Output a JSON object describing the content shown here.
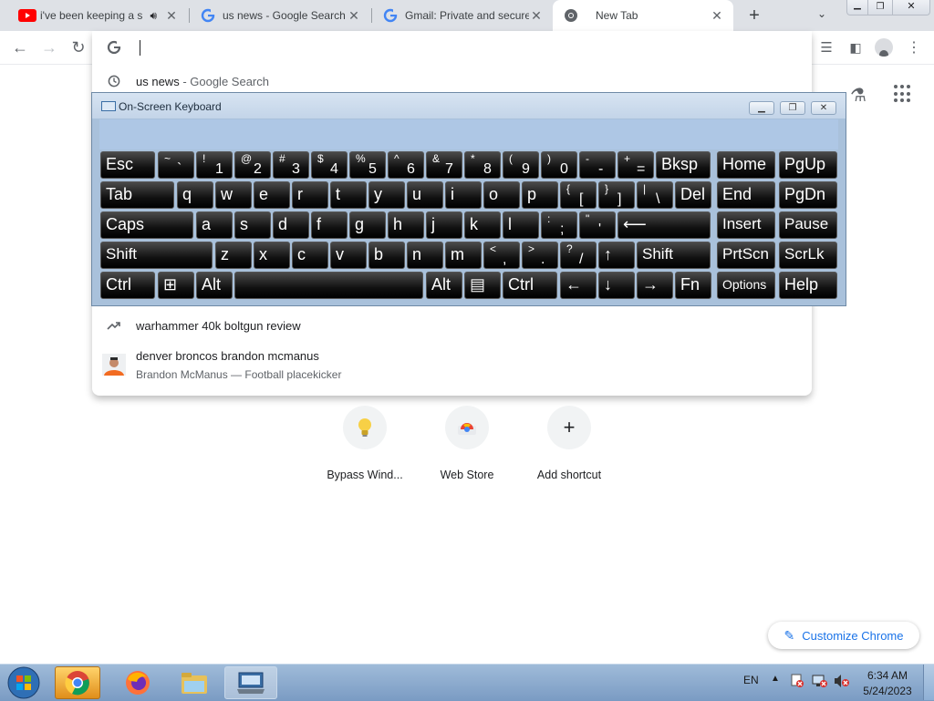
{
  "tabs": [
    {
      "title": "i've been keeping a s",
      "icon": "youtube-icon"
    },
    {
      "title": "us news - Google Search",
      "icon": "google-icon"
    },
    {
      "title": "Gmail: Private and secure",
      "icon": "google-icon"
    },
    {
      "title": "New Tab",
      "icon": "chrome-icon"
    }
  ],
  "new_tab_symbol": "+",
  "omnibox": {
    "value": ""
  },
  "suggestions": [
    {
      "text": "us news",
      "suffix": " - Google Search",
      "icon": "history-icon"
    },
    {
      "text": "warhammer 40k boltgun review",
      "icon": "trending-icon"
    },
    {
      "text": "denver broncos brandon mcmanus",
      "subtitle": "Brandon McManus — Football placekicker",
      "icon": "person-thumbnail"
    }
  ],
  "osk": {
    "title": "On-Screen Keyboard",
    "rows": [
      [
        {
          "m": "Esc"
        },
        {
          "s": "~",
          "b": "`"
        },
        {
          "s": "!",
          "b": "1"
        },
        {
          "s": "@",
          "b": "2"
        },
        {
          "s": "#",
          "b": "3"
        },
        {
          "s": "$",
          "b": "4"
        },
        {
          "s": "%",
          "b": "5"
        },
        {
          "s": "^",
          "b": "6"
        },
        {
          "s": "&",
          "b": "7"
        },
        {
          "s": "*",
          "b": "8"
        },
        {
          "s": "(",
          "b": "9"
        },
        {
          "s": ")",
          "b": "0"
        },
        {
          "s": "-",
          "b": "-"
        },
        {
          "s": "+",
          "b": "="
        },
        {
          "m": "Bksp"
        },
        {
          "m": "Home"
        },
        {
          "m": "PgUp"
        }
      ],
      [
        {
          "m": "Tab"
        },
        {
          "m": "q"
        },
        {
          "m": "w"
        },
        {
          "m": "e"
        },
        {
          "m": "r"
        },
        {
          "m": "t"
        },
        {
          "m": "y"
        },
        {
          "m": "u"
        },
        {
          "m": "i"
        },
        {
          "m": "o"
        },
        {
          "m": "p"
        },
        {
          "s": "{",
          "b": "["
        },
        {
          "s": "}",
          "b": "]"
        },
        {
          "s": "|",
          "b": "\\"
        },
        {
          "m": "Del"
        },
        {
          "m": "End"
        },
        {
          "m": "PgDn"
        }
      ],
      [
        {
          "m": "Caps"
        },
        {
          "m": "a"
        },
        {
          "m": "s"
        },
        {
          "m": "d"
        },
        {
          "m": "f"
        },
        {
          "m": "g"
        },
        {
          "m": "h"
        },
        {
          "m": "j"
        },
        {
          "m": "k"
        },
        {
          "m": "l"
        },
        {
          "s": ":",
          "b": ";"
        },
        {
          "s": "\"",
          "b": "'"
        },
        {
          "m": "⟵"
        },
        {
          "m": "Insert"
        },
        {
          "m": "Pause"
        }
      ],
      [
        {
          "m": "Shift"
        },
        {
          "m": "z"
        },
        {
          "m": "x"
        },
        {
          "m": "c"
        },
        {
          "m": "v"
        },
        {
          "m": "b"
        },
        {
          "m": "n"
        },
        {
          "m": "m"
        },
        {
          "s": "<",
          "b": ","
        },
        {
          "s": ">",
          "b": "."
        },
        {
          "s": "?",
          "b": "/"
        },
        {
          "m": "↑"
        },
        {
          "m": "Shift"
        },
        {
          "m": "PrtScn"
        },
        {
          "m": "ScrLk"
        }
      ],
      [
        {
          "m": "Ctrl"
        },
        {
          "m": "⊞"
        },
        {
          "m": "Alt"
        },
        {
          "m": ""
        },
        {
          "m": "Alt"
        },
        {
          "m": "▤"
        },
        {
          "m": "Ctrl"
        },
        {
          "m": "←"
        },
        {
          "m": "↓"
        },
        {
          "m": "→"
        },
        {
          "m": "Fn"
        },
        {
          "m": "Options"
        },
        {
          "m": "Help"
        }
      ]
    ]
  },
  "shortcuts": [
    {
      "label": "Bypass Wind...",
      "icon": "lightbulb-icon"
    },
    {
      "label": "Web Store",
      "icon": "webstore-icon"
    },
    {
      "label": "Add shortcut",
      "icon": "plus-icon"
    }
  ],
  "customize_label": "Customize Chrome",
  "taskbar": {
    "lang": "EN",
    "time": "6:34 AM",
    "date": "5/24/2023"
  },
  "colors": {
    "accent": "#1a73e8",
    "taskbar": "#8aa9cf",
    "osk_frame": "#a9c1db"
  }
}
